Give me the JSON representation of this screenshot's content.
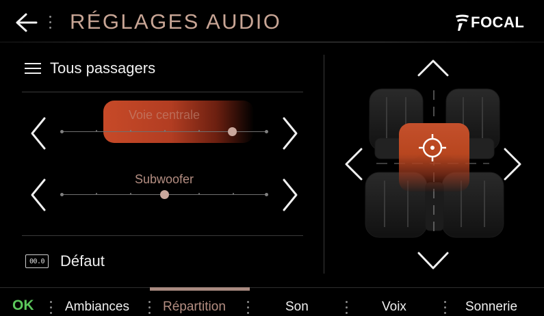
{
  "header": {
    "title": "RÉGLAGES AUDIO",
    "brand": "FOCAL"
  },
  "left_panel": {
    "menu_label": "Tous passagers",
    "sliders": [
      {
        "label": "Voie centrale",
        "value": 0.83,
        "highlighted": true
      },
      {
        "label": "Subwoofer",
        "value": 0.5,
        "highlighted": false
      }
    ],
    "default_icon_text": "00.0",
    "default_label": "Défaut"
  },
  "tabs": {
    "ok": "OK",
    "items": [
      "Ambiances",
      "Répartition",
      "Son",
      "Voix",
      "Sonnerie"
    ],
    "active": "Répartition"
  },
  "colors": {
    "accent": "#c74a28",
    "title": "#c8a595",
    "ok": "#5cc85c",
    "active_tab": "#b48e82"
  },
  "icons": {
    "back": "arrow-left-icon",
    "menu": "hamburger-icon",
    "left": "chevron-left-icon",
    "right": "chevron-right-icon",
    "up": "chevron-up-icon",
    "down": "chevron-down-icon",
    "target": "target-icon",
    "default": "reset-icon",
    "brand": "focal-logo-icon"
  }
}
